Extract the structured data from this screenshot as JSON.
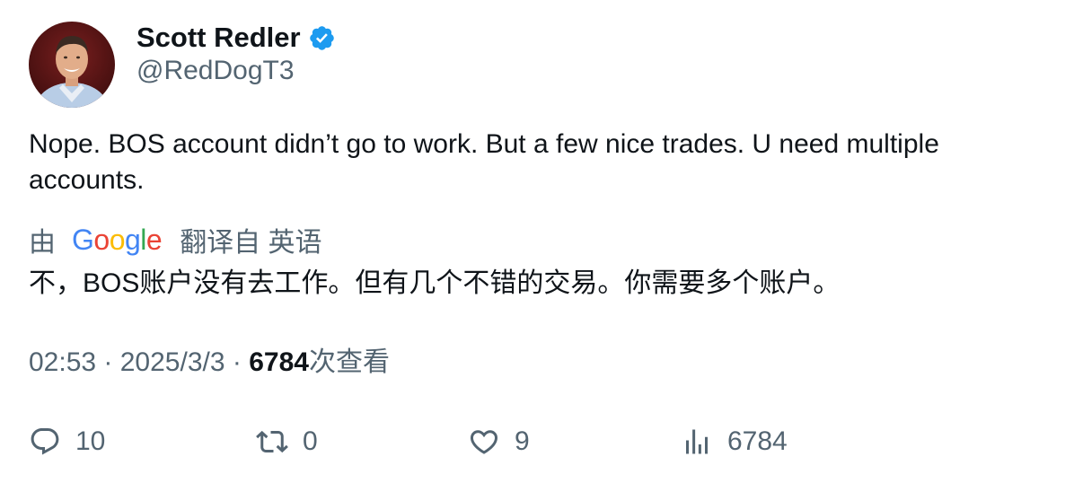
{
  "author": {
    "display_name": "Scott Redler",
    "handle": "@RedDogT3",
    "verified": true,
    "verified_color": "#1d9bf0"
  },
  "tweet": {
    "text": "Nope. BOS account didn’t go to work.  But a few nice trades. U need multiple accounts."
  },
  "translation": {
    "prefix": "由",
    "provider_logo_text": "Google",
    "suffix": "翻译自 英语",
    "text": "不，BOS账户没有去工作。但有几个不错的交易。你需要多个账户。"
  },
  "meta": {
    "time": "02:53",
    "separator": "·",
    "date": "2025/3/3",
    "views_count": "6784",
    "views_label": "次查看"
  },
  "actions": {
    "reply": {
      "icon": "reply-icon",
      "count": "10"
    },
    "retweet": {
      "icon": "retweet-icon",
      "count": "0"
    },
    "like": {
      "icon": "heart-icon",
      "count": "9"
    },
    "views": {
      "icon": "analytics-icon",
      "count": "6784"
    }
  },
  "colors": {
    "text_primary": "#0f1419",
    "text_secondary": "#536471",
    "google_blue": "#4285f4",
    "google_red": "#ea4335",
    "google_yellow": "#fbbc05",
    "google_green": "#34a853"
  }
}
